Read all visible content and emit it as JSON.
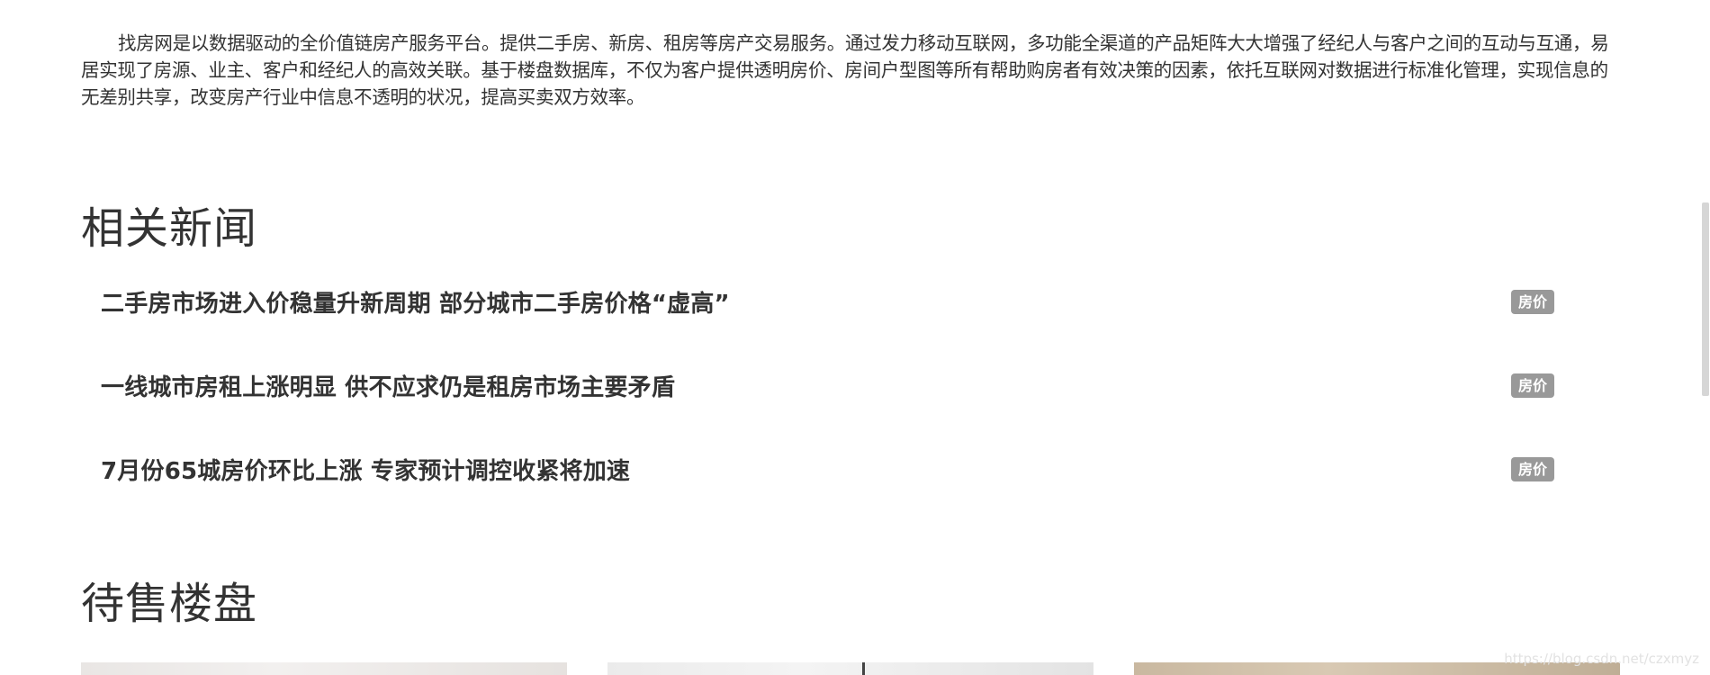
{
  "intro": {
    "text": "找房网是以数据驱动的全价值链房产服务平台。提供二手房、新房、租房等房产交易服务。通过发力移动互联网，多功能全渠道的产品矩阵大大增强了经纪人与客户之间的互动与互通，易居实现了房源、业主、客户和经纪人的高效关联。基于楼盘数据库，不仅为客户提供透明房价、房间户型图等所有帮助购房者有效决策的因素，依托互联网对数据进行标准化管理，实现信息的无差别共享，改变房产行业中信息不透明的状况，提高买卖双方效率。"
  },
  "news": {
    "title": "相关新闻",
    "items": [
      {
        "label": "二手房市场进入价稳量升新周期 部分城市二手房价格“虚高”",
        "tag": "房价"
      },
      {
        "label": "一线城市房租上涨明显 供不应求仍是租房市场主要矛盾",
        "tag": "房价"
      },
      {
        "label": "7月份65城房价环比上涨 专家预计调控收紧将加速",
        "tag": "房价"
      }
    ]
  },
  "listings": {
    "title": "待售楼盘"
  },
  "watermark": "https://blog.csdn.net/czxmyz"
}
